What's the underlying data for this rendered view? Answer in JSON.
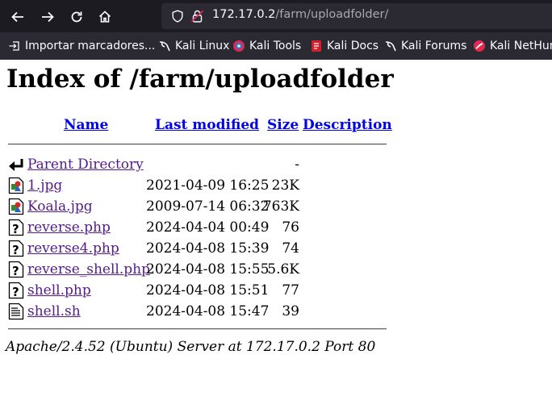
{
  "browser": {
    "url_host": "172.17.0.2",
    "url_path": "/farm/uploadfolder/",
    "bookmarks": [
      {
        "label": "Importar marcadores...",
        "icon": "import-icon"
      },
      {
        "label": "Kali Linux",
        "icon": "kali-dragon-icon"
      },
      {
        "label": "Kali Tools",
        "icon": "kali-tools-icon"
      },
      {
        "label": "Kali Docs",
        "icon": "kali-docs-icon"
      },
      {
        "label": "Kali Forums",
        "icon": "kali-dragon-icon"
      },
      {
        "label": "Kali NetHun",
        "icon": "nethunter-icon"
      }
    ]
  },
  "page": {
    "title": "Index of /farm/uploadfolder",
    "columns": {
      "name": "Name",
      "last_modified": "Last modified",
      "size": "Size",
      "description": "Description"
    },
    "parent": {
      "name": "Parent Directory",
      "size": "-",
      "icon": "back-arrow-icon"
    },
    "files": [
      {
        "name": "1.jpg",
        "modified": "2021-04-09 16:25",
        "size": "23K",
        "icon": "image-file-icon"
      },
      {
        "name": "Koala.jpg",
        "modified": "2009-07-14 06:32",
        "size": "763K",
        "icon": "image-file-icon"
      },
      {
        "name": "reverse.php",
        "modified": "2024-04-04 00:49",
        "size": "76",
        "icon": "unknown-file-icon"
      },
      {
        "name": "reverse4.php",
        "modified": "2024-04-08 15:39",
        "size": "74",
        "icon": "unknown-file-icon"
      },
      {
        "name": "reverse_shell.php",
        "modified": "2024-04-08 15:55",
        "size": "5.6K",
        "icon": "unknown-file-icon"
      },
      {
        "name": "shell.php",
        "modified": "2024-04-08 15:51",
        "size": "77",
        "icon": "unknown-file-icon"
      },
      {
        "name": "shell.sh",
        "modified": "2024-04-08 15:47",
        "size": "39",
        "icon": "text-file-icon"
      }
    ],
    "footer": "Apache/2.4.52 (Ubuntu) Server at 172.17.0.2 Port 80"
  }
}
